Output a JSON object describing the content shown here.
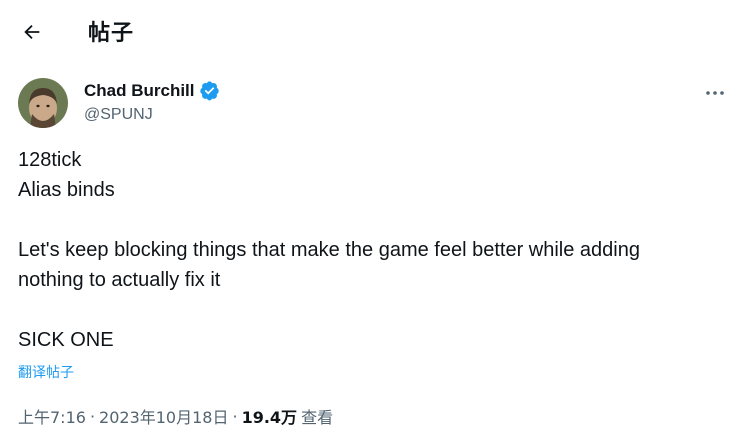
{
  "header": {
    "title": "帖子"
  },
  "tweet": {
    "author": {
      "name": "Chad Burchill",
      "handle": "@SPUNJ"
    },
    "lines": [
      "128tick",
      "Alias binds",
      "Let's keep blocking things that make the game feel better while adding",
      "nothing to actually fix it",
      "SICK ONE"
    ],
    "translate_label": "翻译帖子",
    "time": "上午7:16",
    "date": "2023年10月18日",
    "views_count": "19.4万",
    "views_label": "查看",
    "separator": "·"
  },
  "colors": {
    "accent": "#1d9bf0",
    "text": "#0f1419",
    "secondary": "#536471"
  },
  "icons": {
    "back": "arrow-left-icon",
    "verified": "verified-badge-icon",
    "more": "more-horizontal-icon"
  }
}
